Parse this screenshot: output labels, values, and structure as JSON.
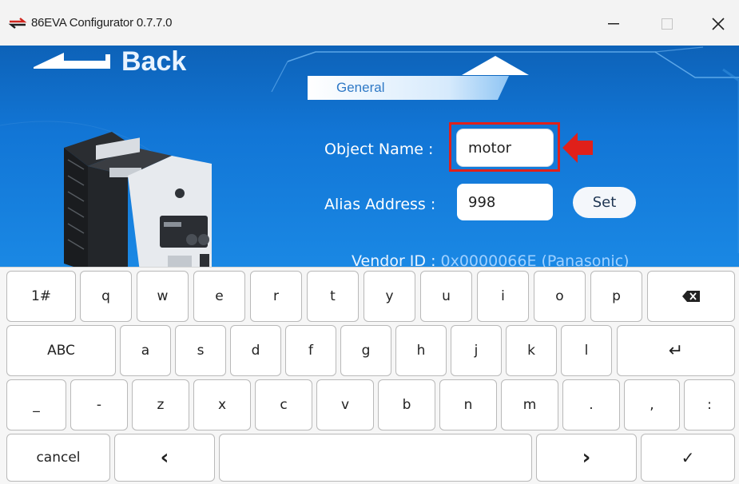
{
  "window": {
    "title": "86EVA Configurator 0.7.7.0",
    "minimize_glyph": "—",
    "maximize_glyph": "☐",
    "close_glyph": "✕"
  },
  "nav": {
    "back_label": "Back"
  },
  "tabs": {
    "general_label": "General"
  },
  "form": {
    "object_name_label": "Object Name :",
    "object_name_value": "motor",
    "alias_label": "Alias Address :",
    "alias_value": "998",
    "set_label": "Set",
    "vendor_label": "Vendor ID :",
    "vendor_value": "0x0000066E (Panasonic)"
  },
  "keyboard": {
    "row1": [
      "1#",
      "q",
      "w",
      "e",
      "r",
      "t",
      "y",
      "u",
      "i",
      "o",
      "p"
    ],
    "row2": [
      "ABC",
      "a",
      "s",
      "d",
      "f",
      "g",
      "h",
      "j",
      "k",
      "l"
    ],
    "row3": [
      "_",
      "-",
      "z",
      "x",
      "c",
      "v",
      "b",
      "n",
      "m",
      ".",
      ",",
      ":"
    ],
    "cancel_label": "cancel",
    "left_glyph": "‹",
    "right_glyph": "›",
    "done_glyph": "✓",
    "enter_glyph": "↵"
  },
  "colors": {
    "accent_blue": "#1276d6",
    "highlight_red": "#e0201a"
  }
}
